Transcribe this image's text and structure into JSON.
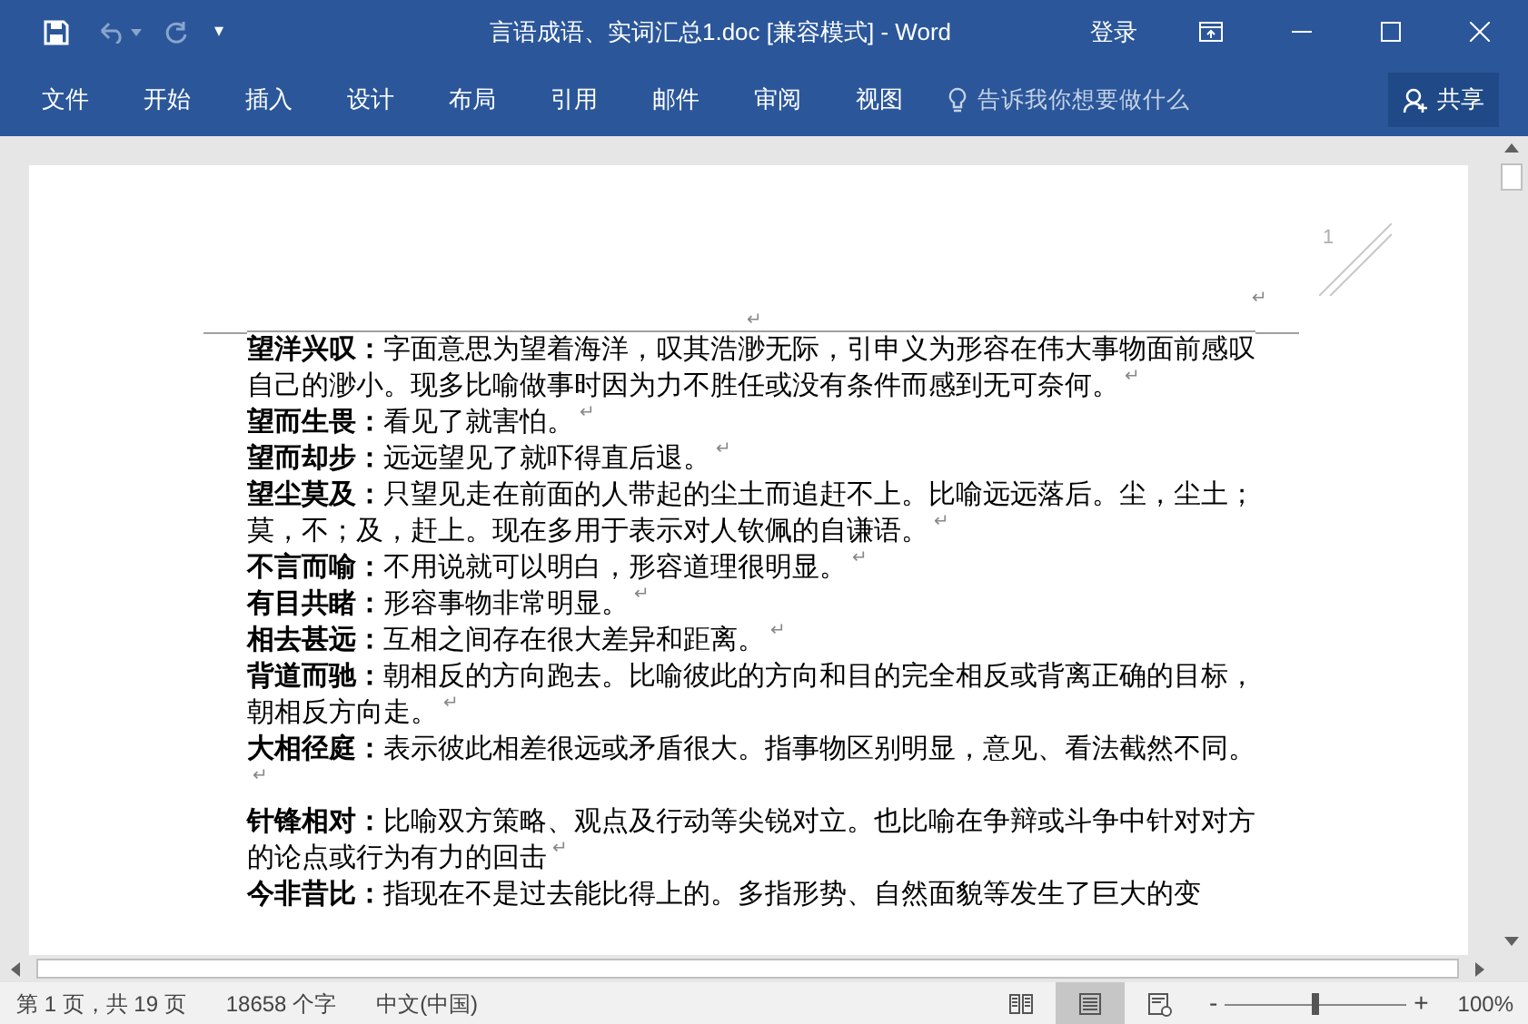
{
  "window": {
    "title": "言语成语、实词汇总1.doc [兼容模式] - Word",
    "sign_in": "登录"
  },
  "quick_access": {
    "more": "▾"
  },
  "ribbon": {
    "tabs": [
      {
        "label": "文件",
        "selected": false
      },
      {
        "label": "开始",
        "selected": false
      },
      {
        "label": "插入",
        "selected": false
      },
      {
        "label": "设计",
        "selected": false
      },
      {
        "label": "布局",
        "selected": false
      },
      {
        "label": "引用",
        "selected": false
      },
      {
        "label": "邮件",
        "selected": false
      },
      {
        "label": "审阅",
        "selected": false
      },
      {
        "label": "视图",
        "selected": false
      }
    ],
    "tell_me": {
      "placeholder": "告诉我你想要做什么"
    },
    "share": "共享"
  },
  "document": {
    "header_marks": [
      "↵",
      "↵"
    ],
    "page_number": "1",
    "entries": [
      {
        "term": "望洋兴叹：",
        "text": "字面意思为望着海洋，叹其浩渺无际，引申义为形容在伟大事物面前感叹自己的渺小。现多比喻做事时因为力不胜任或没有条件而感到无可奈何。",
        "mark": "↵"
      },
      {
        "term": "望而生畏：",
        "text": "看见了就害怕。",
        "mark": "↵"
      },
      {
        "term": "望而却步：",
        "text": "远远望见了就吓得直后退。",
        "mark": "↵"
      },
      {
        "term": "望尘莫及：",
        "text": "只望见走在前面的人带起的尘土而追赶不上。比喻远远落后。尘，尘土；莫，不；及，赶上。现在多用于表示对人钦佩的自谦语。",
        "mark": "↵"
      },
      {
        "term": "不言而喻：",
        "text": "不用说就可以明白，形容道理很明显。",
        "mark": "↵"
      },
      {
        "term": "有目共睹：",
        "text": "形容事物非常明显。",
        "mark": "↵"
      },
      {
        "term": "相去甚远：",
        "text": "互相之间存在很大差异和距离。",
        "mark": "↵"
      },
      {
        "term": "背道而驰：",
        "text": "朝相反的方向跑去。比喻彼此的方向和目的完全相反或背离正确的目标，朝相反方向走。",
        "mark": "↵"
      },
      {
        "term": "大相径庭：",
        "text": "表示彼此相差很远或矛盾很大。指事物区别明显，意见、看法截然不同。",
        "mark": "↵"
      },
      {
        "term": "针锋相对：",
        "text": "比喻双方策略、观点及行动等尖锐对立。也比喻在争辩或斗争中针对对方的论点或行为有力的回击",
        "mark": "↵"
      },
      {
        "term": "今非昔比：",
        "text": "指现在不是过去能比得上的。多指形势、自然面貌等发生了巨大的变"
      }
    ]
  },
  "status_bar": {
    "page": "第 1 页，共 19 页",
    "words": "18658 个字",
    "language": "中文(中国)",
    "views": [
      {
        "kind": "read",
        "selected": false
      },
      {
        "kind": "print",
        "selected": true
      },
      {
        "kind": "web",
        "selected": false
      }
    ],
    "zoom_out": "-",
    "zoom_in": "+",
    "zoom": {
      "level": 0.5
    },
    "zoom_text": "100%"
  }
}
